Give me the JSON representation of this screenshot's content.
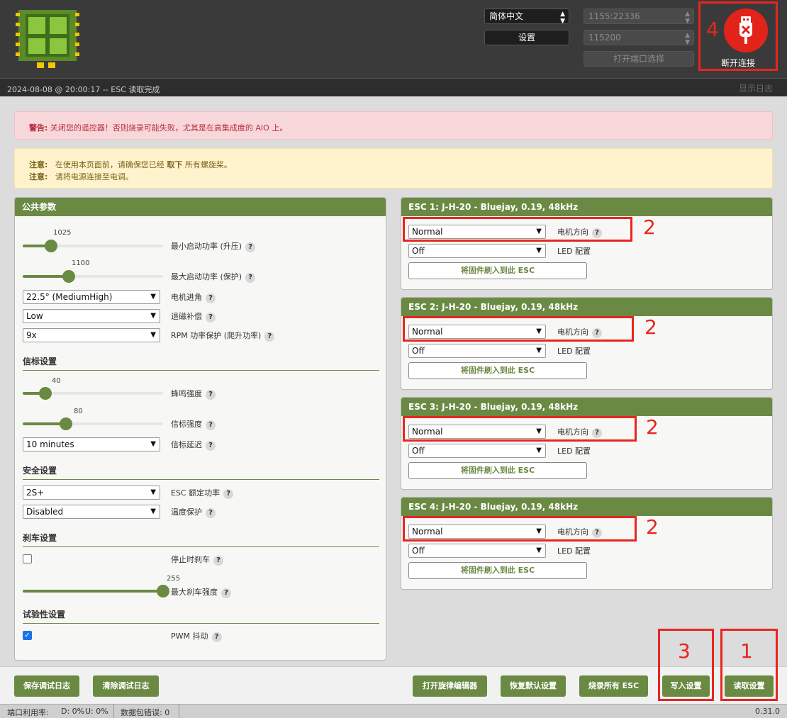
{
  "header": {
    "language": "简体中文",
    "settings_label": "设置",
    "port": "1155:22336",
    "baud": "115200",
    "open_port_label": "打开端口选择",
    "connect_label": "断开连接",
    "annotation_4": "4"
  },
  "status": {
    "message": "2024-08-08 @ 20:00:17 -- ESC 读取完成",
    "show_log": "显示日志"
  },
  "alerts": {
    "warning_prefix": "警告:",
    "warning_text": " 关闭您的遥控器！否则烧录可能失败，尤其是在高集成度的 AIO 上。",
    "note1_prefix": "注意:",
    "note1_a": "在使用本页面前，请确保您已经",
    "note1_b": "取下",
    "note1_c": "所有螺旋桨。",
    "note2_prefix": "注意:",
    "note2_text": "请将电源连接至电调。"
  },
  "common": {
    "title": "公共参数",
    "min_startup": {
      "value": "1025",
      "label": "最小启动功率 (升压)",
      "fraction": 0.2
    },
    "max_startup": {
      "value": "1100",
      "label": "最大启动功率 (保护)",
      "fraction": 0.33
    },
    "timing": {
      "value": "22.5° (MediumHigh)",
      "label": "电机进角"
    },
    "demag": {
      "value": "Low",
      "label": "退磁补偿"
    },
    "rpm_protect": {
      "value": "9x",
      "label": "RPM 功率保护 (爬升功率)"
    },
    "beacon_title": "信标设置",
    "beep_strength": {
      "value": "40",
      "label": "蜂鸣强度",
      "fraction": 0.16
    },
    "beacon_strength": {
      "value": "80",
      "label": "信标强度",
      "fraction": 0.31
    },
    "beacon_delay": {
      "value": "10 minutes",
      "label": "信标延迟"
    },
    "safety_title": "安全设置",
    "rated_power": {
      "value": "2S+",
      "label": "ESC 额定功率"
    },
    "temp_protect": {
      "value": "Disabled",
      "label": "温度保护"
    },
    "brake_title": "刹车设置",
    "brake_on_stop": {
      "checked": false,
      "label": "停止时刹车"
    },
    "max_brake": {
      "value": "255",
      "label": "最大刹车强度",
      "fraction": 1.0
    },
    "experimental_title": "试验性设置",
    "pwm_dither": {
      "checked": true,
      "label": "PWM 抖动"
    }
  },
  "escs": [
    {
      "title": "ESC 1: J-H-20 - Bluejay, 0.19, 48kHz",
      "direction": "Normal",
      "direction_label": "电机方向",
      "led": "Off",
      "led_label": "LED 配置",
      "flash_label": "将固件刷入到此 ESC",
      "annotation": "2"
    },
    {
      "title": "ESC 2: J-H-20 - Bluejay, 0.19, 48kHz",
      "direction": "Normal",
      "direction_label": "电机方向",
      "led": "Off",
      "led_label": "LED 配置",
      "flash_label": "将固件刷入到此 ESC",
      "annotation": "2"
    },
    {
      "title": "ESC 3: J-H-20 - Bluejay, 0.19, 48kHz",
      "direction": "Normal",
      "direction_label": "电机方向",
      "led": "Off",
      "led_label": "LED 配置",
      "flash_label": "将固件刷入到此 ESC",
      "annotation": "2"
    },
    {
      "title": "ESC 4: J-H-20 - Bluejay, 0.19, 48kHz",
      "direction": "Normal",
      "direction_label": "电机方向",
      "led": "Off",
      "led_label": "LED 配置",
      "flash_label": "将固件刷入到此 ESC",
      "annotation": "2"
    }
  ],
  "footer": {
    "save_log": "保存调试日志",
    "clear_log": "清除调试日志",
    "melody_editor": "打开旋律编辑器",
    "restore_defaults": "恢复默认设置",
    "flash_all": "烧录所有 ESC",
    "write_settings": "写入设置",
    "read_settings": "读取设置",
    "annotation_3": "3",
    "annotation_1": "1"
  },
  "bottom": {
    "port_usage": "端口利用率:",
    "down": "D: 0%",
    "up": "U: 0%",
    "packet_errors": "数据包错误: 0",
    "version": "0.31.0"
  },
  "colors": {
    "accent": "#6a8a43",
    "annotation_red": "#e8251f",
    "connect_red": "#e2231a"
  }
}
